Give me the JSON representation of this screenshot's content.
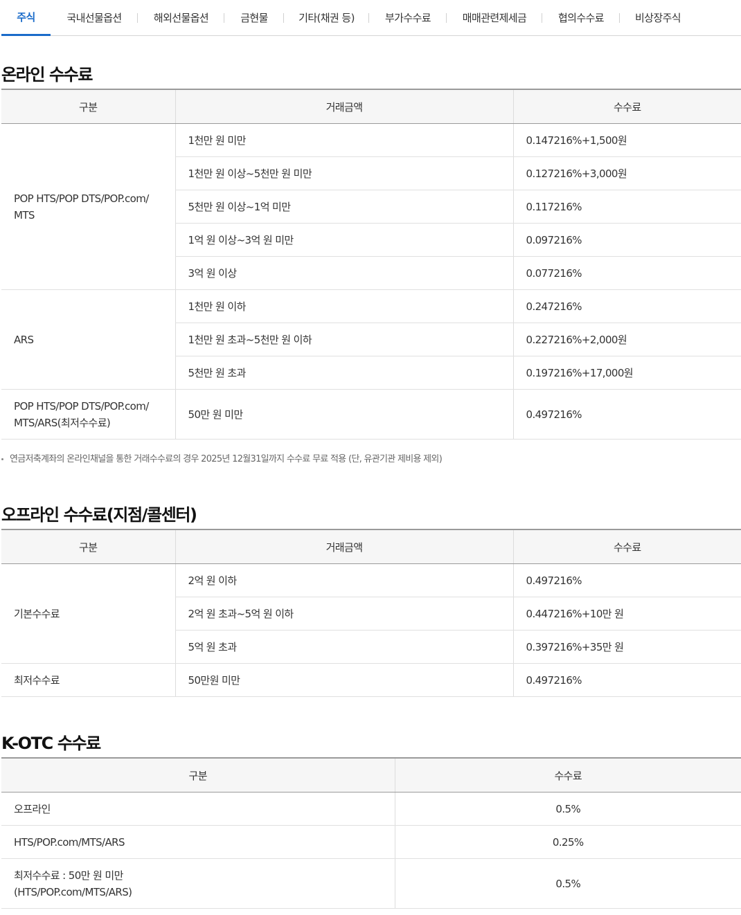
{
  "tabs": [
    "주식",
    "국내선물옵션",
    "해외선물옵션",
    "금현물",
    "기타(채권 등)",
    "부가수수료",
    "매매관련제세금",
    "협의수수료",
    "비상장주식"
  ],
  "online": {
    "title": "온라인 수수료",
    "headers": [
      "구분",
      "거래금액",
      "수수료"
    ],
    "groups": [
      {
        "name": "POP HTS/POP DTS/POP.com/ MTS",
        "rows": [
          {
            "amount": "1천만 원 미만",
            "fee": "0.147216%+1,500원"
          },
          {
            "amount": "1천만 원 이상~5천만 원 미만",
            "fee": "0.127216%+3,000원"
          },
          {
            "amount": "5천만 원 이상~1억 미만",
            "fee": "0.117216%"
          },
          {
            "amount": "1억 원 이상~3억 원 미만",
            "fee": "0.097216%"
          },
          {
            "amount": "3억 원 이상",
            "fee": "0.077216%"
          }
        ]
      },
      {
        "name": "ARS",
        "rows": [
          {
            "amount": "1천만 원 이하",
            "fee": "0.247216%"
          },
          {
            "amount": "1천만 원 초과~5천만 원 이하",
            "fee": "0.227216%+2,000원"
          },
          {
            "amount": "5천만 원 초과",
            "fee": "0.197216%+17,000원"
          }
        ]
      },
      {
        "name": "POP HTS/POP DTS/POP.com/ MTS/ARS(최저수수료)",
        "rows": [
          {
            "amount": "50만 원 미만",
            "fee": "0.497216%"
          }
        ]
      }
    ],
    "note": "연금저축계좌의 온라인채널을 통한 거래수수료의 경우 2025년 12월31일까지 수수료 무료 적용 (단, 유관기관 제비용 제외)"
  },
  "offline": {
    "title": "오프라인 수수료(지점/콜센터)",
    "headers": [
      "구분",
      "거래금액",
      "수수료"
    ],
    "groups": [
      {
        "name": "기본수수료",
        "rows": [
          {
            "amount": "2억 원 이하",
            "fee": "0.497216%"
          },
          {
            "amount": "2억 원 초과~5억 원 이하",
            "fee": "0.447216%+10만 원"
          },
          {
            "amount": "5억 원 초과",
            "fee": "0.397216%+35만 원"
          }
        ]
      },
      {
        "name": "최저수수료",
        "rows": [
          {
            "amount": "50만원 미만",
            "fee": "0.497216%"
          }
        ]
      }
    ]
  },
  "kotc": {
    "title": "K-OTC 수수료",
    "headers": [
      "구분",
      "수수료"
    ],
    "rows": [
      {
        "name": "오프라인",
        "fee": "0.5%"
      },
      {
        "name": "HTS/POP.com/MTS/ARS",
        "fee": "0.25%"
      },
      {
        "name": "최저수수료 : 50만 원 미만 (HTS/POP.com/MTS/ARS)",
        "fee": "0.5%"
      }
    ]
  }
}
